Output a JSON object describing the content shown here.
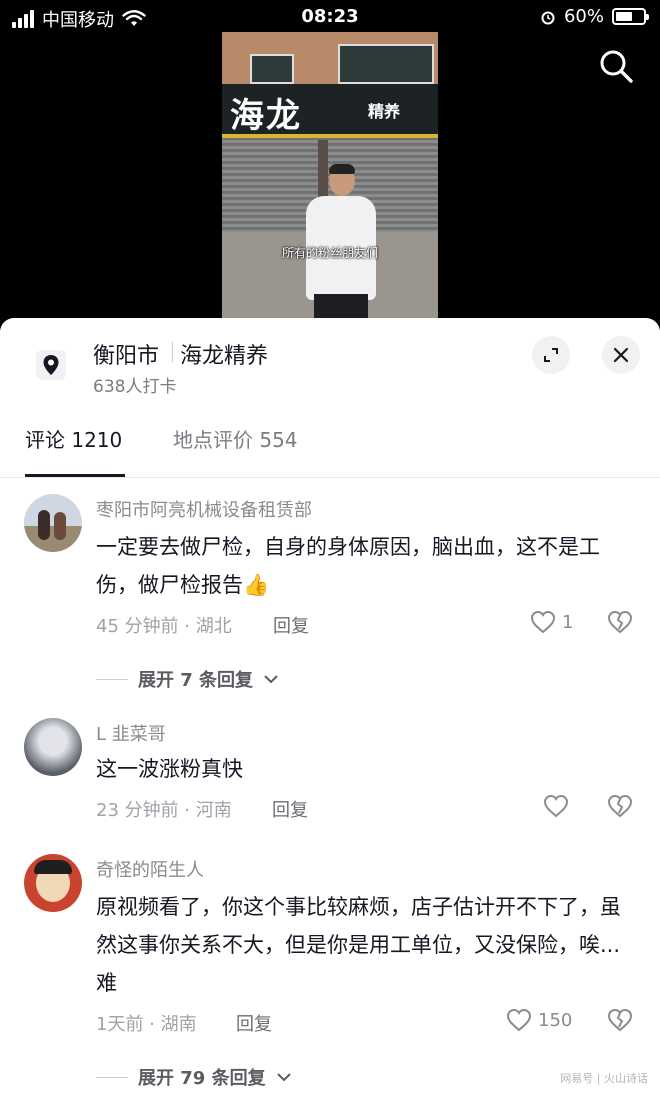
{
  "status_bar": {
    "carrier": "中国移动",
    "time": "08:23",
    "battery": "60%",
    "battery_level": 0.6
  },
  "video": {
    "sign_large": "海龙",
    "sign_small": "精养",
    "subtitle": "所有的粉丝朋友们"
  },
  "location": {
    "city": "衡阳市",
    "name": "海龙精养",
    "checkins": "638人打卡"
  },
  "tabs": [
    {
      "label": "评论 1210",
      "active": true
    },
    {
      "label": "地点评价 554",
      "active": false
    }
  ],
  "comments": [
    {
      "name": "枣阳市阿亮机械设备租赁部",
      "text": "一定要去做尸检，自身的身体原因，脑出血，这不是工伤，做尸检报告👍",
      "meta": "45 分钟前 · 湖北",
      "reply": "回复",
      "likes": "1",
      "expand": "展开 7 条回复"
    },
    {
      "name": "L 韭菜哥",
      "text": "这一波涨粉真快",
      "meta": "23 分钟前 · 河南",
      "reply": "回复",
      "likes": ""
    },
    {
      "name": "奇怪的陌生人",
      "text": "原视频看了，你这个事比较麻烦，店子估计开不下了，虽然这事你关系不大，但是你是用工单位，又没保险，唉...难",
      "meta": "1天前 · 湖南",
      "reply": "回复",
      "likes": "150",
      "expand": "展开 79 条回复"
    }
  ],
  "watermark": "网易号 | 火山诗话",
  "colors": {
    "text": "#161823",
    "secondary": "#8a8b91",
    "background": "#ffffff"
  }
}
